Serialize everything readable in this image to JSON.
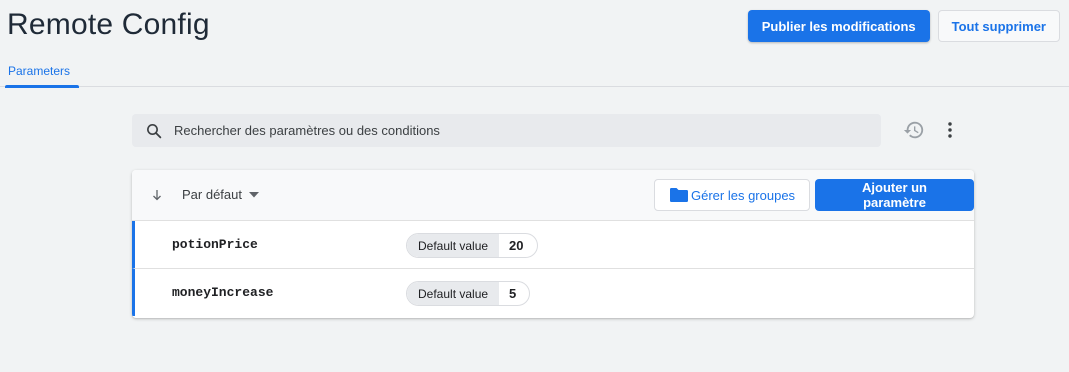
{
  "header": {
    "title": "Remote Config",
    "publish_label": "Publier les modifications",
    "delete_all_label": "Tout supprimer"
  },
  "tabs": [
    {
      "label": "Parameters",
      "active": true
    }
  ],
  "search": {
    "placeholder": "Rechercher des paramètres ou des conditions",
    "value": ""
  },
  "toolbar": {
    "sort_label": "Par défaut",
    "manage_groups_label": "Gérer les groupes",
    "add_parameter_label": "Ajouter un paramètre"
  },
  "parameters": [
    {
      "name": "potionPrice",
      "value_label": "Default value",
      "value": "20"
    },
    {
      "name": "moneyIncrease",
      "value_label": "Default value",
      "value": "5"
    }
  ],
  "colors": {
    "accent": "#1a73e8",
    "background": "#f1f3f4",
    "title": "#1f2a37"
  },
  "icons": {
    "search": "search-icon",
    "history": "history-icon",
    "more": "more-vert-icon",
    "sort": "arrow-down-icon",
    "dropdown": "caret-down-icon",
    "folder": "folder-icon"
  }
}
